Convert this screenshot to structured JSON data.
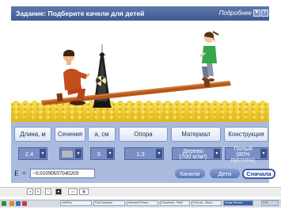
{
  "window": {
    "title": "Задание: Подберите качели для детей",
    "more_link": "Подробнее",
    "btn_dropdown": "▼",
    "btn_help": "?"
  },
  "controls": {
    "headers": [
      "Длина, м",
      "Сечения",
      "а, см",
      "Опора",
      "Материал",
      "Конструкция"
    ],
    "length_value": "2.4",
    "section_value": "",
    "a_value": "5",
    "support_value": "1:3",
    "material_line1": "Дерево",
    "material_line2": "(700 кг/м³)",
    "construction_line1": "Полый",
    "construction_line2": "(80% пустоты)",
    "dropdown_arrow": "▼"
  },
  "energy": {
    "label": "E",
    "equals": "=",
    "value": "−0.010906970402​69"
  },
  "buttons": {
    "swing": "Качели",
    "kids": "Дети",
    "reset": "Сначала"
  },
  "colors": {
    "titlebar": "#4a66a0",
    "panel": "#a9bbdf",
    "board": "#b5581c",
    "sand": "#efcf3c"
  },
  "taskbar": {
    "items": [
      "InfoPlus",
      "Flat Computer",
      "Microsoft Power...",
      "Document - Paint",
      "Fruit pic - Micro...",
      "Image Resizer..."
    ],
    "clock": "9:41"
  }
}
